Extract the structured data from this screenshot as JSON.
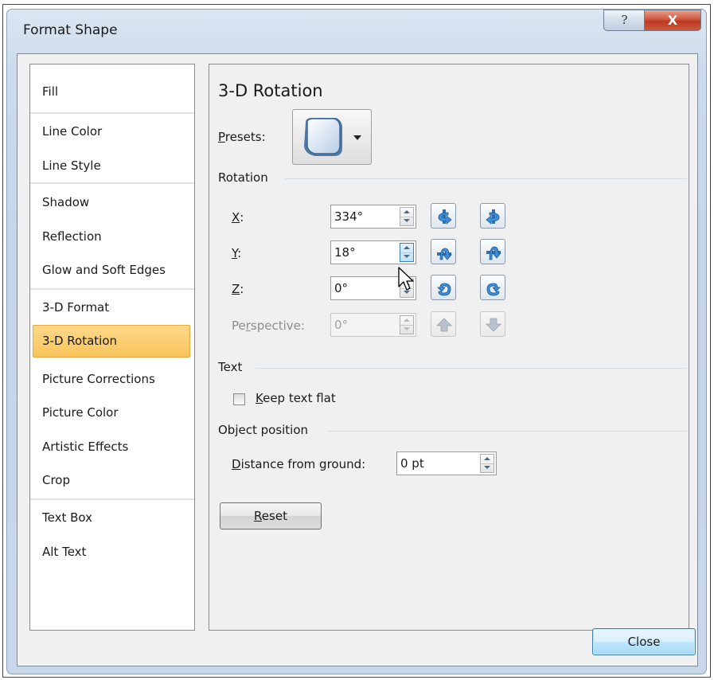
{
  "window": {
    "title": "Format Shape",
    "help_glyph": "?",
    "close_glyph": "X"
  },
  "nav": {
    "items": [
      {
        "label": "Fill"
      },
      {
        "label": "Line Color"
      },
      {
        "label": "Line Style"
      },
      {
        "label": "Shadow"
      },
      {
        "label": "Reflection"
      },
      {
        "label": "Glow and Soft Edges"
      },
      {
        "label": "3-D Format"
      },
      {
        "label": "3-D Rotation",
        "selected": true
      },
      {
        "label": "Picture Corrections"
      },
      {
        "label": "Picture Color"
      },
      {
        "label": "Artistic Effects"
      },
      {
        "label": "Crop"
      },
      {
        "label": "Text Box"
      },
      {
        "label": "Alt Text"
      }
    ]
  },
  "panel": {
    "heading": "3-D Rotation",
    "presets": {
      "label_u": "P",
      "label_rest": "resets:"
    },
    "rotation": {
      "group_label": "Rotation",
      "x": {
        "label_u": "X",
        "label_rest": ":",
        "value": "334°"
      },
      "y": {
        "label_u": "Y",
        "label_rest": ":",
        "value": "18°"
      },
      "z": {
        "label_u": "Z",
        "label_rest": ":",
        "value": "0°"
      },
      "perspective": {
        "label_pre": "Pe",
        "label_u": "r",
        "label_rest": "spective:",
        "value": "0°",
        "disabled": true
      }
    },
    "text": {
      "group_label": "Text",
      "keep_flat": {
        "label_u": "K",
        "label_rest": "eep text flat",
        "checked": false
      }
    },
    "object_position": {
      "group_label": "Object position",
      "distance": {
        "label_u": "D",
        "label_rest": "istance from ground:",
        "value": "0 pt"
      }
    },
    "reset": {
      "label_u": "R",
      "label_rest": "eset"
    }
  },
  "footer": {
    "close_label": "Close"
  },
  "colors": {
    "selection": "#f8c45a",
    "accent_blue": "#2f6fb3",
    "dialog_frame": "#c8d8ea"
  }
}
